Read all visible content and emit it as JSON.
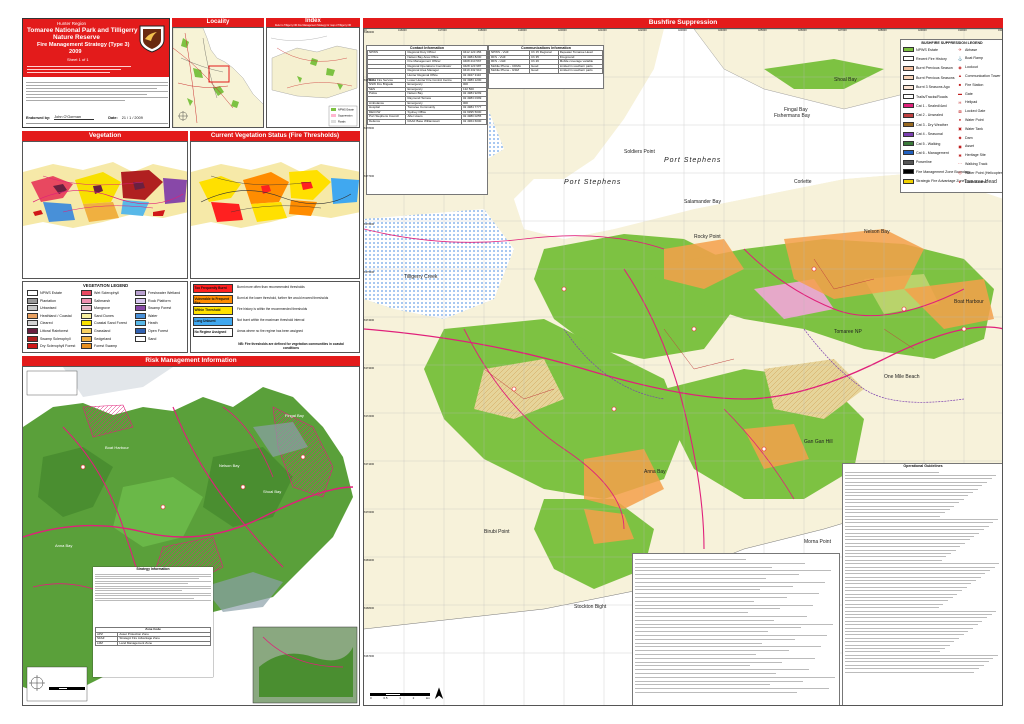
{
  "title_block": {
    "region": "Hunter Region",
    "park_line1": "Tomaree National Park and Tilligerry",
    "park_line2": "Nature Reserve",
    "strategy_line1": "Fire Management Strategy (Type 3)",
    "year": "2009",
    "sheet": "Sheet 1 of 1",
    "endorsed_label": "Endorsed by:",
    "endorsed_name": "John O'Gorman",
    "date_label": "Date:",
    "date_value": "21 / 1 / 2009",
    "mini_legend": [
      "NPWS Estate",
      "Bushfire Suppression",
      "Local Roads"
    ]
  },
  "headers": {
    "locality": "Locality",
    "index": "Index",
    "index_sub": "Refer to Tilligerry NR Fire Management Strategy for map of Tilligerry NR",
    "bushfire": "Bushfire Suppression",
    "vegetation": "Vegetation",
    "current_veg": "Current Vegetation Status (Fire Thresholds)",
    "risk": "Risk Management Information"
  },
  "veg_legend": {
    "title": "VEGETATION LEGEND",
    "items": [
      {
        "label": "NPWS Estate",
        "color": "#ffffff"
      },
      {
        "label": "Plantation",
        "color": "#9a9a9a"
      },
      {
        "label": "Urbanised",
        "color": "#c8c8c8"
      },
      {
        "label": "Heathland / Coastal",
        "color": "#e8a060"
      },
      {
        "label": "Cleared",
        "color": "#d4d4d4"
      },
      {
        "label": "Littoral Rainforest",
        "color": "#6a2040"
      },
      {
        "label": "Swamp Sclerophyll",
        "color": "#b02020"
      },
      {
        "label": "Dry Sclerophyll Forest",
        "color": "#d01818"
      },
      {
        "label": "Wet Sclerophyll",
        "color": "#e84860"
      },
      {
        "label": "Saltmarsh",
        "color": "#f090b0"
      },
      {
        "label": "Mangrove",
        "color": "#e8b8c8"
      },
      {
        "label": "Sand Dunes",
        "color": "#f8f0a0"
      },
      {
        "label": "Coastal Sand Forest",
        "color": "#f8e000"
      },
      {
        "label": "Grassland",
        "color": "#f8d060"
      },
      {
        "label": "Sedgeland",
        "color": "#f0b040"
      },
      {
        "label": "Forest Swamp",
        "color": "#e89020"
      },
      {
        "label": "Freshwater Wetland",
        "color": "#b8a0d0"
      },
      {
        "label": "Rock Platform",
        "color": "#d8c8f0"
      },
      {
        "label": "Swamp Forest",
        "color": "#8848a8"
      },
      {
        "label": "Water",
        "color": "#4890d8"
      },
      {
        "label": "Heath",
        "color": "#58b8e8"
      },
      {
        "label": "Open Forest",
        "color": "#3060b0"
      },
      {
        "label": "Sand",
        "color": "#ffffff"
      }
    ]
  },
  "threshold_legend": [
    {
      "label": "Too Frequently Burnt",
      "color": "#ff2020",
      "desc": "Burnt more often than recommended thresholds"
    },
    {
      "label": "Vulnerable to Frequent Fire",
      "color": "#ff8c00",
      "desc": "Burnt at the lower threshold, further fire would exceed thresholds"
    },
    {
      "label": "Within Threshold",
      "color": "#ffe000",
      "desc": "Fire history is within the recommended thresholds"
    },
    {
      "label": "Long Unburnt",
      "color": "#40a8f0",
      "desc": "Not burnt within the maximum threshold interval"
    },
    {
      "label": "No Regime Assigned",
      "color": "#ffffff",
      "desc": "Areas where no fire regime has been assigned"
    }
  ],
  "threshold_note": "NB: Fire thresholds are defined for vegetation communities in coastal conditions",
  "contact_title": "Contact Information",
  "contacts": [
    [
      "NPWS",
      "Regional Duty Officer",
      "0412 123 456"
    ],
    [
      "",
      "Nelson Bay Area Office",
      "02 4984 8200"
    ],
    [
      "",
      "Fire Management Officer",
      "0408 210 567"
    ],
    [
      "",
      "Regional Operations Coordinator",
      "0428 123 987"
    ],
    [
      "",
      "Regional Area Manager",
      "0419 432 910"
    ],
    [
      "",
      "Hunter Regional Office",
      "02 4927 3110"
    ],
    [
      "Rural Fire Service",
      "Lower Hunter Fire Control Centre",
      "02 4983 1200"
    ],
    [
      "NSW Fire Brigade",
      "Emergency",
      "000"
    ],
    [
      "SES",
      "Emergency",
      "132 500"
    ],
    [
      "Police",
      "Nelson Bay",
      "02 4984 9299"
    ],
    [
      "",
      "Raymond Terrace",
      "02 4983 0399"
    ],
    [
      "Ambulance",
      "Emergency",
      "000"
    ],
    [
      "Hospital",
      "Tomaree Community",
      "02 4984 7777"
    ],
    [
      "DECCW",
      "Sydney Office",
      "02 9995 5000"
    ],
    [
      "Port Stephens Council",
      "After Hours",
      "02 4980 0255"
    ],
    [
      "Defence",
      "RAAF Base Williamtown",
      "02 4964 6000"
    ]
  ],
  "comms_title": "Communications Information",
  "comms": [
    [
      "NPWS - VHF",
      "Ch 15 Regional",
      "Repeater Tomaree Head"
    ],
    [
      "RFS - VHF",
      "Ch 35",
      "Fireground"
    ],
    [
      "RFS - UHF",
      "Ch 26",
      "Mobile coverage variable"
    ],
    [
      "Mobile Phone - CDMA",
      "Good",
      "Limited in southern parts"
    ],
    [
      "Mobile Phone - GSM",
      "Good",
      "Limited in southern parts"
    ]
  ],
  "bushfire_legend": {
    "title": "BUSHFIRE SUPPRESSION LEGEND",
    "left": [
      "NPWS Estate",
      "Recent Fire History",
      "Burnt Previous Season",
      "Burnt Previous Seasons",
      "Burnt 3 Seasons Ago",
      "Trails/Tracks/Roads",
      "Cat 1 - Sealed/4wd",
      "Cat 2 - Unsealed",
      "Cat 3 - Dry Weather",
      "Cat 4 - Seasonal",
      "Cat 5 - Walking",
      "Cat 6 - Management",
      "Powerline",
      "Fire Management Zone Boundary",
      "Strategic Fire Advantage Zone"
    ],
    "right": [
      "Airbase",
      "Boat Ramp",
      "Lookout",
      "Communication Tower",
      "Fire Station",
      "Gate",
      "Helipad",
      "Locked Gate",
      "Water Point",
      "Water Tank",
      "Dam",
      "Asset",
      "Heritage Site",
      "Walking Track",
      "Water Point (Helicopter)",
      "Dozer Access"
    ]
  },
  "map_labels": [
    "Port Stephens",
    "Fingal Bay",
    "Shoal Bay",
    "Nelson Bay",
    "Corlette",
    "Salamander Bay",
    "Soldiers Point",
    "Tomaree Head",
    "Boat Harbour",
    "One Mile Beach",
    "Anna Bay",
    "Fishermans Bay",
    "Tomaree NP",
    "Port Stephens",
    "Birubi Point",
    "Stockton Bight",
    "Gan Gan Hill",
    "Tilligerry Creek",
    "Rocky Point",
    "Morna Point"
  ],
  "risk_map_labels": [
    "Boat Harbour",
    "Anna Bay",
    "Fingal Bay",
    "Nelson Bay",
    "Shoal Bay"
  ],
  "strategy_table_title": "Strategy Information",
  "text_table_title": "Operational Guidelines",
  "zone_table": {
    "title": "Zone Code",
    "rows": [
      [
        "APZ",
        "Asset Protection Zone"
      ],
      [
        "SFAZ",
        "Strategic Fire Advantage Zone"
      ],
      [
        "LMZ",
        "Land Management Zone"
      ]
    ]
  },
  "scale": {
    "units": "km",
    "ticks": [
      "0",
      "0.5",
      "1",
      "2"
    ]
  },
  "easting_ticks": [
    "415000",
    "416000",
    "417000",
    "418000",
    "419000",
    "420000",
    "421000",
    "422000",
    "423000",
    "424000",
    "425000",
    "426000",
    "427000",
    "428000",
    "429000",
    "430000",
    "431000"
  ],
  "northing_ticks": [
    "6380000",
    "6379000",
    "6378000",
    "6377000",
    "6376000",
    "6375000",
    "6374000",
    "6373000",
    "6372000",
    "6371000",
    "6370000",
    "6369000",
    "6368000",
    "6367000"
  ],
  "colors": {
    "header_red": "#e31b1b",
    "npws_green": "#7dc242",
    "water": "#ffffff",
    "road": "#e0207a",
    "orange_roads": "#f4a04a"
  }
}
